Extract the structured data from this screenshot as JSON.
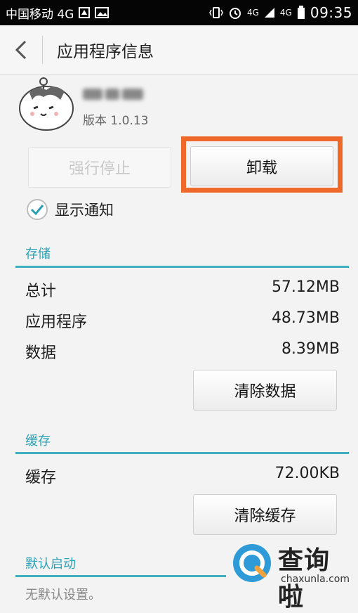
{
  "status_bar": {
    "carrier": "中国移动 4G",
    "time": "09:35",
    "net_left": "4G",
    "net_right": "4G"
  },
  "title_bar": {
    "title": "应用程序信息"
  },
  "app": {
    "version": "版本 1.0.13"
  },
  "buttons": {
    "force_stop": "强行停止",
    "uninstall": "卸载"
  },
  "notifications": {
    "label": "显示通知",
    "checked": true
  },
  "storage": {
    "title": "存储",
    "rows": [
      {
        "label": "总计",
        "value": "57.12MB"
      },
      {
        "label": "应用程序",
        "value": "48.73MB"
      },
      {
        "label": "数据",
        "value": "8.39MB"
      }
    ],
    "clear_label": "清除数据"
  },
  "cache": {
    "title": "缓存",
    "rows": [
      {
        "label": "缓存",
        "value": "72.00KB"
      }
    ],
    "clear_label": "清除缓存"
  },
  "default_launch": {
    "title": "默认启动",
    "subtitle": "无默认设置。"
  },
  "watermark": {
    "brand": "查询啦",
    "domain": "chaxunla.com"
  },
  "colors": {
    "accent": "#3fb0c0",
    "highlight": "#ef6a2a"
  }
}
